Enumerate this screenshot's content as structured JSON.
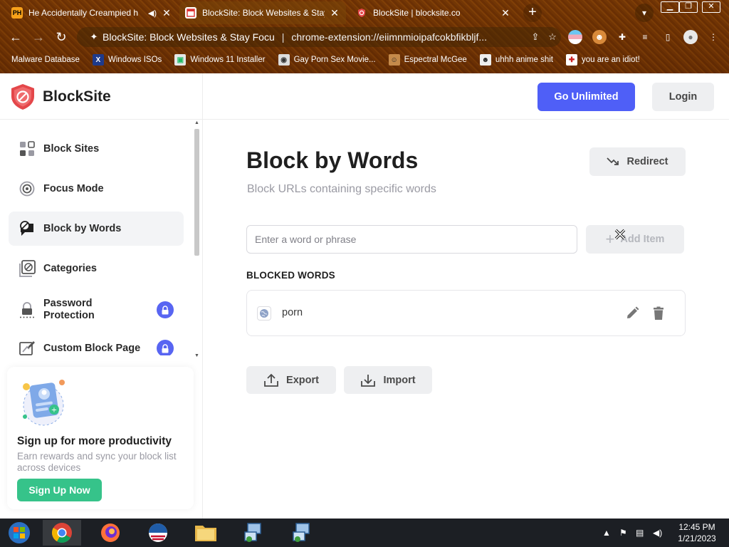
{
  "browser": {
    "tabs": [
      {
        "title": "He Accidentally Creampied h",
        "favicon": "PH",
        "muted_icon": "speaker-icon"
      },
      {
        "title": "BlockSite: Block Websites & Stay"
      },
      {
        "title": "BlockSite | blocksite.co"
      }
    ],
    "omnibox": {
      "title": "BlockSite: Block Websites & Stay Focu",
      "url": "chrome-extension://eiimnmioipafcokbfikbljf..."
    },
    "bookmarks": [
      "Malware Database",
      "Windows ISOs",
      "Windows 11 Installer",
      "Gay Porn Sex Movie...",
      "Espectral McGee",
      "uhhh anime shit",
      "you are an idiot!"
    ]
  },
  "app": {
    "name": "BlockSite",
    "accent": "#4f5ff7",
    "header": {
      "unlimited_label": "Go Unlimited",
      "login_label": "Login"
    },
    "menu": [
      {
        "label": "Block Sites",
        "icon": "grid-blocks-icon"
      },
      {
        "label": "Focus Mode",
        "icon": "target-icon"
      },
      {
        "label": "Block by Words",
        "icon": "speech-block-icon",
        "active": true
      },
      {
        "label": "Categories",
        "icon": "categories-icon"
      },
      {
        "label": "Password Protection",
        "icon": "padlock-dots-icon",
        "locked": true
      },
      {
        "label": "Custom Block Page",
        "icon": "custom-page-icon",
        "locked": true
      }
    ],
    "promo": {
      "title": "Sign up for more productivity",
      "description": "Earn rewards and sync your block list across devices",
      "button": "Sign Up Now"
    },
    "main": {
      "title": "Block by Words",
      "subtitle": "Block URLs containing specific words",
      "redirect_label": "Redirect",
      "input_placeholder": "Enter a word or phrase",
      "add_label": "Add Item",
      "section_label": "BLOCKED WORDS",
      "blocked_words": [
        "porn"
      ],
      "export_label": "Export",
      "import_label": "Import"
    }
  },
  "taskbar": {
    "time": "12:45 PM",
    "date": "1/21/2023"
  }
}
